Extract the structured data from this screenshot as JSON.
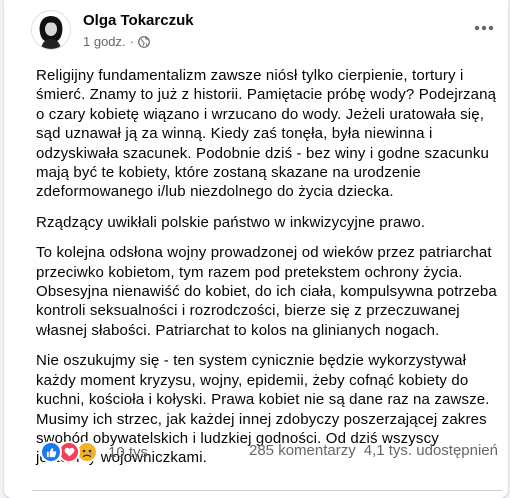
{
  "post": {
    "author": "Olga Tokarczuk",
    "time": "1 godz.",
    "separator": "·",
    "audience_icon": "globe-icon",
    "menu_icon": "more-horizontal-icon",
    "paragraphs": [
      "Religijny fundamentalizm zawsze niósł tylko cierpienie, tortury i śmierć. Znamy to już z historii. Pamiętacie próbę wody? Podejrzaną o czary kobietę wiązano i wrzucano do wody. Jeżeli uratowała się, sąd uznawał ją za winną. Kiedy zaś tonęła, była niewinna i odzyskiwała szacunek. Podobnie dziś - bez winy i godne szacunku mają być te kobiety, które zostaną skazane na urodzenie zdeformowanego i/lub niezdolnego do życia dziecka.",
      "Rządzący uwikłali polskie państwo w inkwizycyjne prawo.",
      "To kolejna odsłona wojny prowadzonej od wieków przez patriarchat przeciwko kobietom, tym razem pod pretekstem ochrony życia. Obsesyjna nienawiść do kobiet, do ich ciała, kompulsywna potrzeba kontroli seksualności i rozrodczości, bierze się z przeczuwanej własnej słabości. Patriarchat to kolos na glinianych nogach.",
      "Nie oszukujmy się - ten system cynicznie będzie wykorzystywał każdy moment kryzysu, wojny, epidemii, żeby cofnąć kobiety do kuchni, kościoła i kołyski. Prawa kobiet nie są dane raz na zawsze. Musimy ich strzec, jak każdej innej zdobyczy poszerzającej zakres swobód obywatelskich i ludzkiej godności. Od dziś wszyscy jesteśmy wojowniczkami."
    ]
  },
  "footer": {
    "reaction_icons": [
      "like-icon",
      "love-icon",
      "sad-icon"
    ],
    "reactions_count": "10 tys.",
    "comments": "285 komentarzy",
    "shares": "4,1 tys. udostępnień"
  },
  "colors": {
    "text_primary": "#050505",
    "text_secondary": "#65676b",
    "like_blue": "#1877f2",
    "love_red": "#f33e58",
    "sad_yellow": "#f7b125",
    "background": "#f0f2f5"
  }
}
